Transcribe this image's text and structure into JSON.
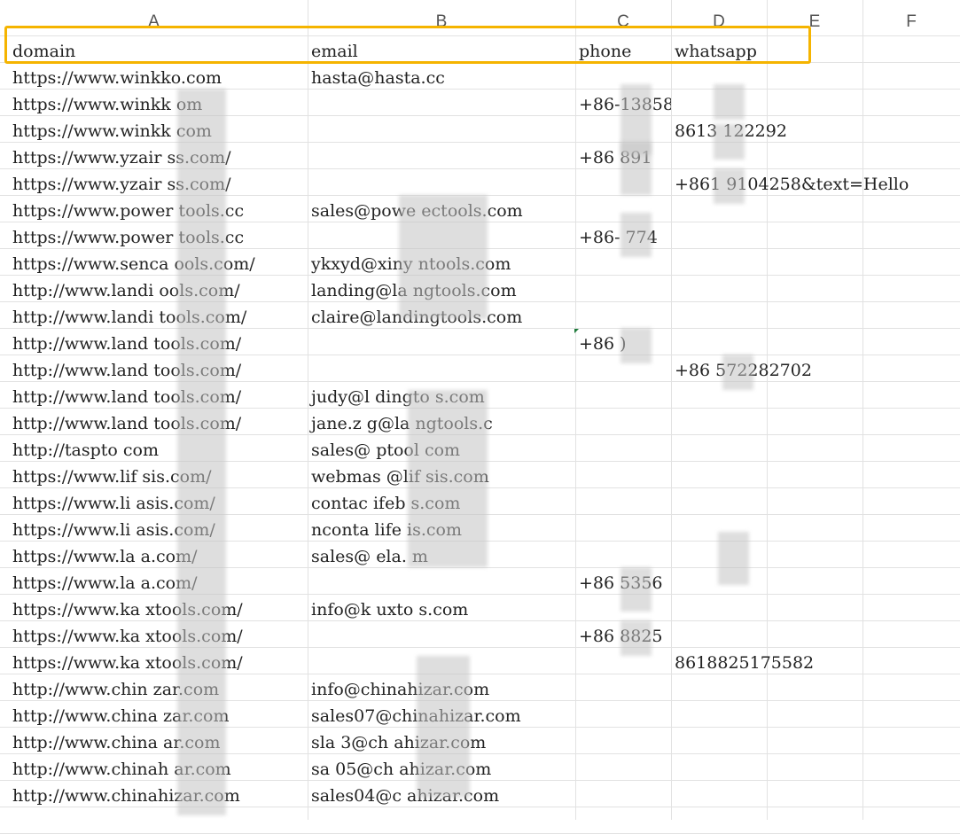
{
  "sheet": {
    "columns": [
      "A",
      "B",
      "C",
      "D",
      "E",
      "F"
    ],
    "header_row": {
      "domain": "domain",
      "email": "email",
      "phone": "phone",
      "whatsapp": "whatsapp"
    },
    "rows": [
      {
        "domain": "https://www.winkko.com",
        "email": "hasta@hasta.cc",
        "phone": "",
        "whatsapp": ""
      },
      {
        "domain": "https://www.winkk  om",
        "email": "",
        "phone": "+86-13858",
        "whatsapp": ""
      },
      {
        "domain": "https://www.winkk  com",
        "email": "",
        "phone": "",
        "whatsapp": "8613    122292"
      },
      {
        "domain": "https://www.yzair   ss.com/",
        "email": "",
        "phone": "+86   891",
        "whatsapp": ""
      },
      {
        "domain": "https://www.yzair   ss.com/",
        "email": "",
        "phone": "",
        "whatsapp": "+861   9104258&text=Hello"
      },
      {
        "domain": "https://www.power   tools.cc",
        "email": "sales@powe   ectools.com",
        "phone": "",
        "whatsapp": ""
      },
      {
        "domain": "https://www.power   tools.cc",
        "email": "",
        "phone": "+86-   774",
        "whatsapp": ""
      },
      {
        "domain": "https://www.senca  ools.com/",
        "email": "ykxyd@xiny    ntools.com",
        "phone": "",
        "whatsapp": ""
      },
      {
        "domain": "http://www.landi   ools.com/",
        "email": "landing@la    ngtools.com",
        "phone": "",
        "whatsapp": ""
      },
      {
        "domain": "http://www.landi  tools.com/",
        "email": "claire@landingtools.com",
        "phone": "",
        "whatsapp": ""
      },
      {
        "domain": "http://www.land   tools.com/",
        "email": "",
        "phone": "+86    )",
        "whatsapp": ""
      },
      {
        "domain": "http://www.land   tools.com/",
        "email": "",
        "phone": "",
        "whatsapp": "+86     572282702"
      },
      {
        "domain": "http://www.land   tools.com/",
        "email": "judy@l    dingto  s.com",
        "phone": "",
        "whatsapp": ""
      },
      {
        "domain": "http://www.land   tools.com/",
        "email": "jane.z   g@la    ngtools.c",
        "phone": "",
        "whatsapp": ""
      },
      {
        "domain": "http://taspto    com",
        "email": "sales@    ptool  com",
        "phone": "",
        "whatsapp": ""
      },
      {
        "domain": "https://www.lif   sis.com/",
        "email": "webmas    @lif   sis.com",
        "phone": "",
        "whatsapp": ""
      },
      {
        "domain": "https://www.li    asis.com/",
        "email": "contac    ifeb    s.com",
        "phone": "",
        "whatsapp": ""
      },
      {
        "domain": "https://www.li    asis.com/",
        "email": "nconta    life   is.com",
        "phone": "",
        "whatsapp": ""
      },
      {
        "domain": "https://www.la    a.com/",
        "email": "sales@    ela.   m",
        "phone": "",
        "whatsapp": ""
      },
      {
        "domain": "https://www.la    a.com/",
        "email": "",
        "phone": "+86   5356",
        "whatsapp": ""
      },
      {
        "domain": "https://www.ka    xtools.com/",
        "email": "info@k    uxto  s.com",
        "phone": "",
        "whatsapp": ""
      },
      {
        "domain": "https://www.ka    xtools.com/",
        "email": "",
        "phone": "+86   8825",
        "whatsapp": ""
      },
      {
        "domain": "https://www.ka    xtools.com/",
        "email": "",
        "phone": "",
        "whatsapp": "8618825175582"
      },
      {
        "domain": "http://www.chin    zar.com",
        "email": "info@chinahizar.com",
        "phone": "",
        "whatsapp": ""
      },
      {
        "domain": "http://www.china    zar.com",
        "email": "sales07@chinahizar.com",
        "phone": "",
        "whatsapp": ""
      },
      {
        "domain": "http://www.china    ar.com",
        "email": "sla    3@ch   ahizar.com",
        "phone": "",
        "whatsapp": ""
      },
      {
        "domain": "http://www.chinah   ar.com",
        "email": "sa    05@ch   ahizar.com",
        "phone": "",
        "whatsapp": ""
      },
      {
        "domain": "http://www.chinahizar.com",
        "email": "sales04@c    ahizar.com",
        "phone": "",
        "whatsapp": ""
      }
    ]
  },
  "colors": {
    "highlight": "#f5b400",
    "grid": "#e2e2e2",
    "text": "#222222"
  }
}
